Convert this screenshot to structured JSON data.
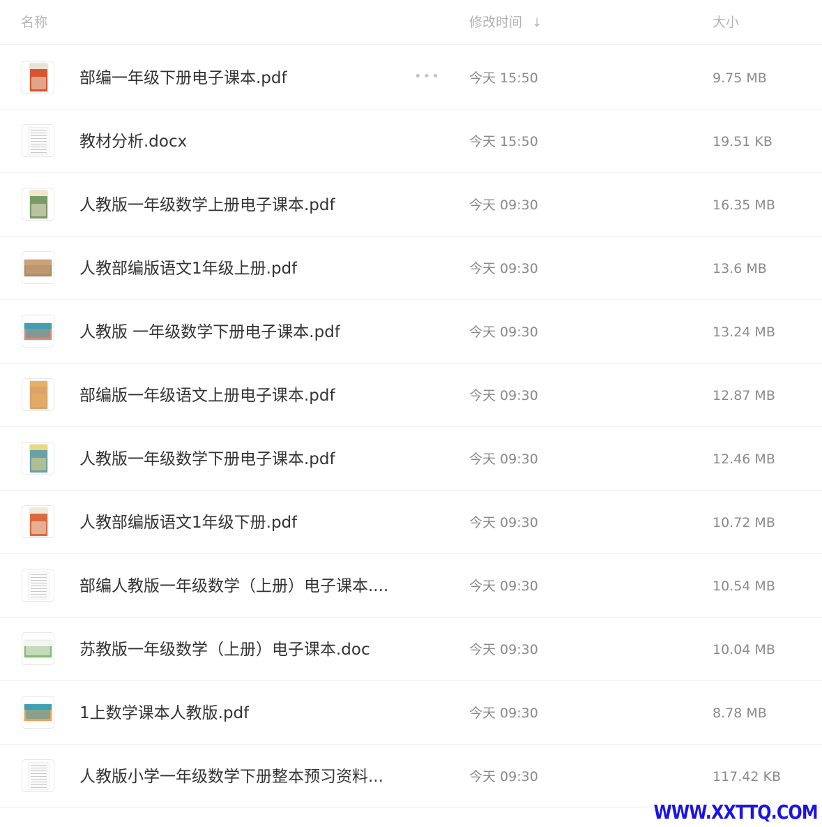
{
  "header": {
    "name_label": "名称",
    "time_label": "修改时间",
    "size_label": "大小",
    "sort_icon": "arrow-down-icon"
  },
  "more_icon": "ellipsis-icon",
  "files": [
    {
      "name": "部编一年级下册电子课本.pdf",
      "time": "今天 15:50",
      "size": "9.75 MB",
      "thumb": "cover",
      "band": "#e8e3d4",
      "pic": "#d9542f"
    },
    {
      "name": "教材分析.docx",
      "time": "今天 15:50",
      "size": "19.51 KB",
      "thumb": "doc"
    },
    {
      "name": "人教版一年级数学上册电子课本.pdf",
      "time": "今天 09:30",
      "size": "16.35 MB",
      "thumb": "cover",
      "band": "#f0e6c8",
      "pic": "#7a9a6a"
    },
    {
      "name": "人教部编版语文1年级上册.pdf",
      "time": "今天 09:30",
      "size": "13.6 MB",
      "thumb": "wide",
      "band": "#c9a27a",
      "pic": "#b08a62"
    },
    {
      "name": "人教版 一年级数学下册电子课本.pdf",
      "time": "今天 09:30",
      "size": "13.24 MB",
      "thumb": "wide",
      "band": "#3fa0b0",
      "pic": "#d98a7a"
    },
    {
      "name": "部编版一年级语文上册电子课本.pdf",
      "time": "今天 09:30",
      "size": "12.87 MB",
      "thumb": "cover",
      "band": "#e8b061",
      "pic": "#d9a36a"
    },
    {
      "name": "人教版一年级数学下册电子课本.pdf",
      "time": "今天 09:30",
      "size": "12.46 MB",
      "thumb": "cover",
      "band": "#e8d97a",
      "pic": "#6aa0a8"
    },
    {
      "name": "人教部编版语文1年级下册.pdf",
      "time": "今天 09:30",
      "size": "10.72 MB",
      "thumb": "cover",
      "band": "#f0e8d8",
      "pic": "#d96a3f"
    },
    {
      "name": "部编人教版一年级数学（上册）电子课本....",
      "time": "今天 09:30",
      "size": "10.54 MB",
      "thumb": "doc"
    },
    {
      "name": "苏教版一年级数学（上册）电子课本.doc",
      "time": "今天 09:30",
      "size": "10.04 MB",
      "thumb": "wide",
      "band": "#f5f5f0",
      "pic": "#8ab87a"
    },
    {
      "name": "1上数学课本人教版.pdf",
      "time": "今天 09:30",
      "size": "8.78 MB",
      "thumb": "wide",
      "band": "#3fa0b0",
      "pic": "#e8a35a"
    },
    {
      "name": "人教版小学一年级数学下册整本预习资料...",
      "time": "今天 09:30",
      "size": "117.42 KB",
      "thumb": "doc"
    }
  ],
  "watermark": "WWW.XXTTQ.COM"
}
